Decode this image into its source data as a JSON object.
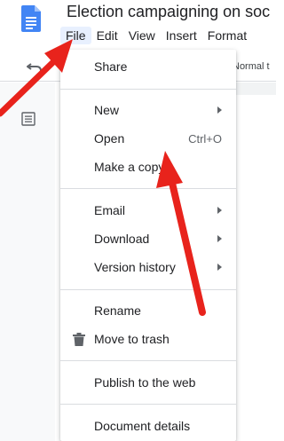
{
  "header": {
    "doc_title": "Election campaigning on soc",
    "icon": "docs-logo"
  },
  "menubar": {
    "items": [
      "File",
      "Edit",
      "View",
      "Insert",
      "Format"
    ]
  },
  "toolbar": {
    "style_select": "Normal t"
  },
  "file_menu": {
    "items": [
      {
        "label": "Share"
      },
      {
        "label": "New"
      },
      {
        "label": "Open",
        "shortcut": "Ctrl+O"
      },
      {
        "label": "Make a copy"
      },
      {
        "label": "Email"
      },
      {
        "label": "Download"
      },
      {
        "label": "Version history"
      },
      {
        "label": "Rename"
      },
      {
        "label": "Move to trash",
        "icon": "trash-icon"
      },
      {
        "label": "Publish to the web"
      },
      {
        "label": "Document details"
      }
    ]
  },
  "colors": {
    "accent": "#4285f4",
    "arrow": "#e8231c",
    "active_menu_bg": "#e8f0fe"
  }
}
